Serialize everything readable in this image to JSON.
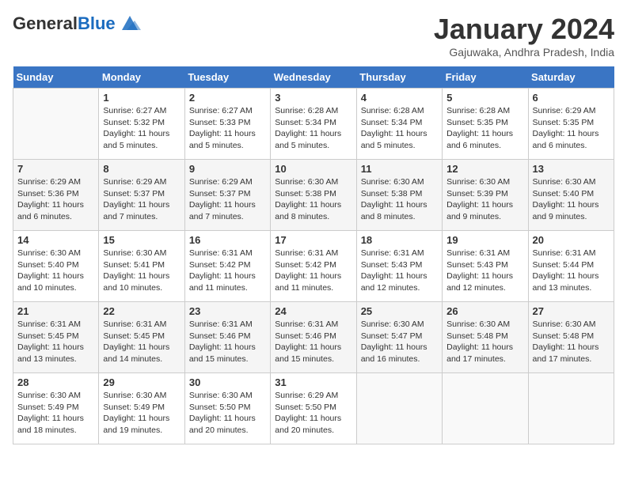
{
  "header": {
    "logo_general": "General",
    "logo_blue": "Blue",
    "month_title": "January 2024",
    "location": "Gajuwaka, Andhra Pradesh, India"
  },
  "days_of_week": [
    "Sunday",
    "Monday",
    "Tuesday",
    "Wednesday",
    "Thursday",
    "Friday",
    "Saturday"
  ],
  "weeks": [
    [
      {
        "day": "",
        "empty": true
      },
      {
        "day": "1",
        "sunrise": "Sunrise: 6:27 AM",
        "sunset": "Sunset: 5:32 PM",
        "daylight": "Daylight: 11 hours and 5 minutes."
      },
      {
        "day": "2",
        "sunrise": "Sunrise: 6:27 AM",
        "sunset": "Sunset: 5:33 PM",
        "daylight": "Daylight: 11 hours and 5 minutes."
      },
      {
        "day": "3",
        "sunrise": "Sunrise: 6:28 AM",
        "sunset": "Sunset: 5:34 PM",
        "daylight": "Daylight: 11 hours and 5 minutes."
      },
      {
        "day": "4",
        "sunrise": "Sunrise: 6:28 AM",
        "sunset": "Sunset: 5:34 PM",
        "daylight": "Daylight: 11 hours and 5 minutes."
      },
      {
        "day": "5",
        "sunrise": "Sunrise: 6:28 AM",
        "sunset": "Sunset: 5:35 PM",
        "daylight": "Daylight: 11 hours and 6 minutes."
      },
      {
        "day": "6",
        "sunrise": "Sunrise: 6:29 AM",
        "sunset": "Sunset: 5:35 PM",
        "daylight": "Daylight: 11 hours and 6 minutes."
      }
    ],
    [
      {
        "day": "7",
        "sunrise": "Sunrise: 6:29 AM",
        "sunset": "Sunset: 5:36 PM",
        "daylight": "Daylight: 11 hours and 6 minutes."
      },
      {
        "day": "8",
        "sunrise": "Sunrise: 6:29 AM",
        "sunset": "Sunset: 5:37 PM",
        "daylight": "Daylight: 11 hours and 7 minutes."
      },
      {
        "day": "9",
        "sunrise": "Sunrise: 6:29 AM",
        "sunset": "Sunset: 5:37 PM",
        "daylight": "Daylight: 11 hours and 7 minutes."
      },
      {
        "day": "10",
        "sunrise": "Sunrise: 6:30 AM",
        "sunset": "Sunset: 5:38 PM",
        "daylight": "Daylight: 11 hours and 8 minutes."
      },
      {
        "day": "11",
        "sunrise": "Sunrise: 6:30 AM",
        "sunset": "Sunset: 5:38 PM",
        "daylight": "Daylight: 11 hours and 8 minutes."
      },
      {
        "day": "12",
        "sunrise": "Sunrise: 6:30 AM",
        "sunset": "Sunset: 5:39 PM",
        "daylight": "Daylight: 11 hours and 9 minutes."
      },
      {
        "day": "13",
        "sunrise": "Sunrise: 6:30 AM",
        "sunset": "Sunset: 5:40 PM",
        "daylight": "Daylight: 11 hours and 9 minutes."
      }
    ],
    [
      {
        "day": "14",
        "sunrise": "Sunrise: 6:30 AM",
        "sunset": "Sunset: 5:40 PM",
        "daylight": "Daylight: 11 hours and 10 minutes."
      },
      {
        "day": "15",
        "sunrise": "Sunrise: 6:30 AM",
        "sunset": "Sunset: 5:41 PM",
        "daylight": "Daylight: 11 hours and 10 minutes."
      },
      {
        "day": "16",
        "sunrise": "Sunrise: 6:31 AM",
        "sunset": "Sunset: 5:42 PM",
        "daylight": "Daylight: 11 hours and 11 minutes."
      },
      {
        "day": "17",
        "sunrise": "Sunrise: 6:31 AM",
        "sunset": "Sunset: 5:42 PM",
        "daylight": "Daylight: 11 hours and 11 minutes."
      },
      {
        "day": "18",
        "sunrise": "Sunrise: 6:31 AM",
        "sunset": "Sunset: 5:43 PM",
        "daylight": "Daylight: 11 hours and 12 minutes."
      },
      {
        "day": "19",
        "sunrise": "Sunrise: 6:31 AM",
        "sunset": "Sunset: 5:43 PM",
        "daylight": "Daylight: 11 hours and 12 minutes."
      },
      {
        "day": "20",
        "sunrise": "Sunrise: 6:31 AM",
        "sunset": "Sunset: 5:44 PM",
        "daylight": "Daylight: 11 hours and 13 minutes."
      }
    ],
    [
      {
        "day": "21",
        "sunrise": "Sunrise: 6:31 AM",
        "sunset": "Sunset: 5:45 PM",
        "daylight": "Daylight: 11 hours and 13 minutes."
      },
      {
        "day": "22",
        "sunrise": "Sunrise: 6:31 AM",
        "sunset": "Sunset: 5:45 PM",
        "daylight": "Daylight: 11 hours and 14 minutes."
      },
      {
        "day": "23",
        "sunrise": "Sunrise: 6:31 AM",
        "sunset": "Sunset: 5:46 PM",
        "daylight": "Daylight: 11 hours and 15 minutes."
      },
      {
        "day": "24",
        "sunrise": "Sunrise: 6:31 AM",
        "sunset": "Sunset: 5:46 PM",
        "daylight": "Daylight: 11 hours and 15 minutes."
      },
      {
        "day": "25",
        "sunrise": "Sunrise: 6:30 AM",
        "sunset": "Sunset: 5:47 PM",
        "daylight": "Daylight: 11 hours and 16 minutes."
      },
      {
        "day": "26",
        "sunrise": "Sunrise: 6:30 AM",
        "sunset": "Sunset: 5:48 PM",
        "daylight": "Daylight: 11 hours and 17 minutes."
      },
      {
        "day": "27",
        "sunrise": "Sunrise: 6:30 AM",
        "sunset": "Sunset: 5:48 PM",
        "daylight": "Daylight: 11 hours and 17 minutes."
      }
    ],
    [
      {
        "day": "28",
        "sunrise": "Sunrise: 6:30 AM",
        "sunset": "Sunset: 5:49 PM",
        "daylight": "Daylight: 11 hours and 18 minutes."
      },
      {
        "day": "29",
        "sunrise": "Sunrise: 6:30 AM",
        "sunset": "Sunset: 5:49 PM",
        "daylight": "Daylight: 11 hours and 19 minutes."
      },
      {
        "day": "30",
        "sunrise": "Sunrise: 6:30 AM",
        "sunset": "Sunset: 5:50 PM",
        "daylight": "Daylight: 11 hours and 20 minutes."
      },
      {
        "day": "31",
        "sunrise": "Sunrise: 6:29 AM",
        "sunset": "Sunset: 5:50 PM",
        "daylight": "Daylight: 11 hours and 20 minutes."
      },
      {
        "day": "",
        "empty": true
      },
      {
        "day": "",
        "empty": true
      },
      {
        "day": "",
        "empty": true
      }
    ]
  ]
}
